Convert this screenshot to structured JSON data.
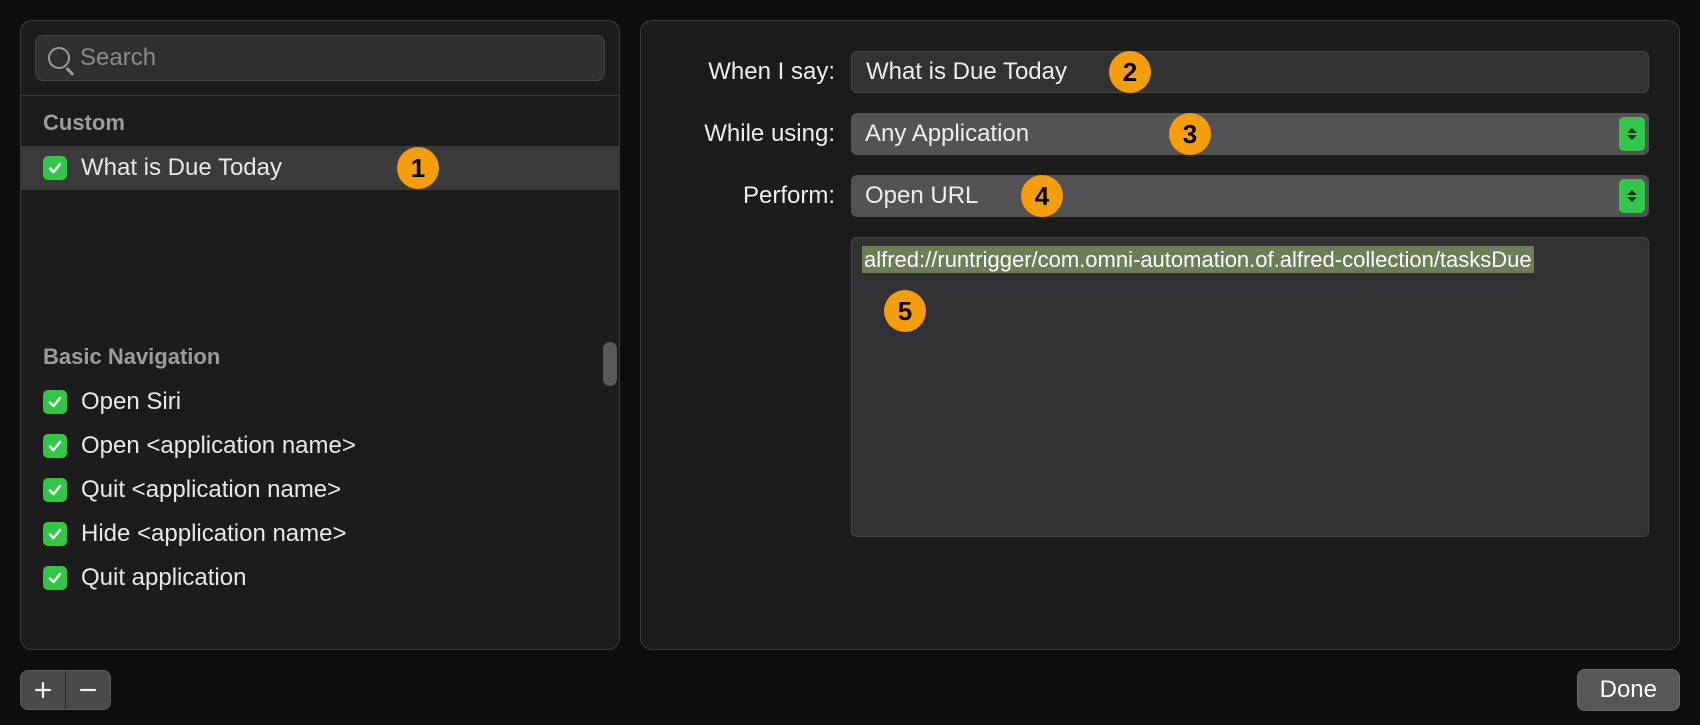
{
  "search": {
    "placeholder": "Search"
  },
  "sections": {
    "custom": {
      "header": "Custom",
      "items": [
        {
          "label": "What is Due Today",
          "enabled": true,
          "selected": true,
          "callout": "1"
        }
      ]
    },
    "basic": {
      "header": "Basic Navigation",
      "items": [
        {
          "label": "Open Siri",
          "enabled": true
        },
        {
          "label": "Open <application name>",
          "enabled": true
        },
        {
          "label": "Quit <application name>",
          "enabled": true
        },
        {
          "label": "Hide <application name>",
          "enabled": true
        },
        {
          "label": "Quit application",
          "enabled": true
        }
      ]
    }
  },
  "form": {
    "when_label": "When I say:",
    "when_value": "What is Due Today",
    "when_callout": "2",
    "using_label": "While using:",
    "using_value": "Any Application",
    "using_callout": "3",
    "perform_label": "Perform:",
    "perform_value": "Open URL",
    "perform_callout": "4",
    "url_value": "alfred://runtrigger/com.omni-automation.of.alfred-collection/tasksDue",
    "url_callout": "5"
  },
  "buttons": {
    "done": "Done"
  }
}
